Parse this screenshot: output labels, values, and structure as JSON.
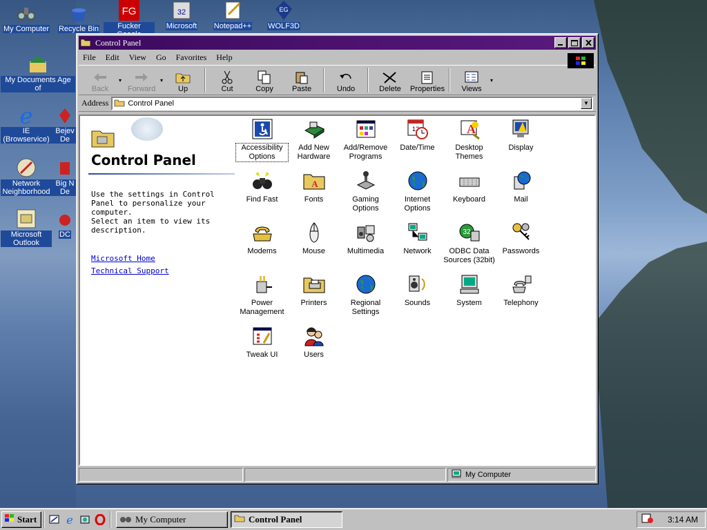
{
  "desktop": {
    "icons": [
      {
        "label": "My Computer",
        "icon": "binoculars-icon"
      },
      {
        "label": "Recycle Bin",
        "icon": "recycle-bin-icon"
      },
      {
        "label": "Fucker Google",
        "icon": "fg-shortcut-icon"
      },
      {
        "label": "Microsoft",
        "icon": "microsoft-shortcut-icon"
      },
      {
        "label": "Notepad++",
        "icon": "notepad-icon"
      },
      {
        "label": "WOLF3D",
        "icon": "wolf3d-icon"
      },
      {
        "label": "My Documents Age of",
        "icon": "my-documents-icon"
      },
      {
        "label": "IE (Browservice)",
        "icon": "ie-icon"
      },
      {
        "label": "Bejev De",
        "icon": "bejeweled-icon"
      },
      {
        "label": "Network Neighborhood",
        "icon": "network-neighborhood-icon"
      },
      {
        "label": "Big N De",
        "icon": "big-n-icon"
      },
      {
        "label": "Microsoft Outlook",
        "icon": "outlook-icon"
      },
      {
        "label": "DC",
        "icon": "dc-icon"
      }
    ]
  },
  "window": {
    "title": "Control Panel",
    "menu": [
      "File",
      "Edit",
      "View",
      "Go",
      "Favorites",
      "Help"
    ],
    "toolbar": {
      "back": "Back",
      "forward": "Forward",
      "up": "Up",
      "cut": "Cut",
      "copy": "Copy",
      "paste": "Paste",
      "undo": "Undo",
      "delete": "Delete",
      "properties": "Properties",
      "views": "Views"
    },
    "address": {
      "label": "Address",
      "value": "Control Panel"
    },
    "left_pane": {
      "title": "Control Panel",
      "desc1": "Use the settings in Control Panel to personalize your computer.",
      "desc2": "Select an item to view its description.",
      "link1": "Microsoft Home",
      "link2": "Technical Support"
    },
    "items": [
      {
        "label": "Accessibility Options",
        "icon": "accessibility-icon"
      },
      {
        "label": "Add New Hardware",
        "icon": "add-hardware-icon"
      },
      {
        "label": "Add/Remove Programs",
        "icon": "add-remove-programs-icon"
      },
      {
        "label": "Date/Time",
        "icon": "calendar-clock-icon"
      },
      {
        "label": "Desktop Themes",
        "icon": "desktop-themes-icon"
      },
      {
        "label": "Display",
        "icon": "display-icon"
      },
      {
        "label": "Find Fast",
        "icon": "binoculars-icon"
      },
      {
        "label": "Fonts",
        "icon": "fonts-folder-icon"
      },
      {
        "label": "Gaming Options",
        "icon": "joystick-icon"
      },
      {
        "label": "Internet Options",
        "icon": "globe-icon"
      },
      {
        "label": "Keyboard",
        "icon": "keyboard-icon"
      },
      {
        "label": "Mail",
        "icon": "mail-icon"
      },
      {
        "label": "Modems",
        "icon": "modem-phone-icon"
      },
      {
        "label": "Mouse",
        "icon": "mouse-icon"
      },
      {
        "label": "Multimedia",
        "icon": "multimedia-icon"
      },
      {
        "label": "Network",
        "icon": "network-icon"
      },
      {
        "label": "ODBC Data Sources (32bit)",
        "icon": "odbc-icon"
      },
      {
        "label": "Passwords",
        "icon": "keys-icon"
      },
      {
        "label": "Power Management",
        "icon": "power-plug-icon"
      },
      {
        "label": "Printers",
        "icon": "printers-folder-icon"
      },
      {
        "label": "Regional Settings",
        "icon": "globe-icon"
      },
      {
        "label": "Sounds",
        "icon": "speaker-icon"
      },
      {
        "label": "System",
        "icon": "computer-icon"
      },
      {
        "label": "Telephony",
        "icon": "telephony-icon"
      },
      {
        "label": "Tweak UI",
        "icon": "tweak-ui-icon"
      },
      {
        "label": "Users",
        "icon": "users-icon"
      }
    ],
    "status": {
      "right": "My Computer"
    }
  },
  "taskbar": {
    "start": "Start",
    "tasks": [
      "My Computer",
      "Control Panel"
    ],
    "clock": "3:14 AM"
  },
  "colors": {
    "titlebar": "#3b0a5e",
    "window": "#c0c0c0",
    "link": "#0000cc"
  }
}
